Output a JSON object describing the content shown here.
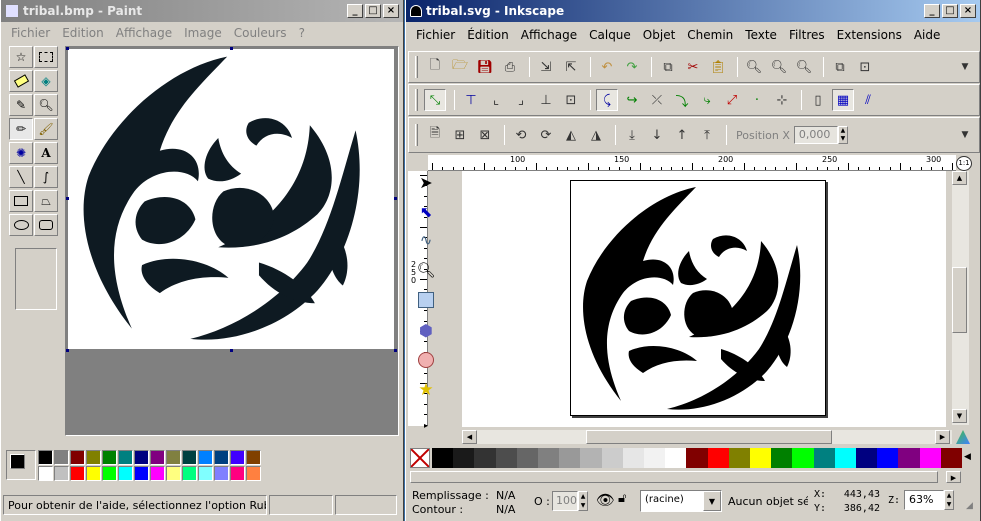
{
  "paint": {
    "title": "tribal.bmp - Paint",
    "menu": [
      "Fichier",
      "Edition",
      "Affichage",
      "Image",
      "Couleurs",
      "?"
    ],
    "palette_top": [
      "#000000",
      "#808080",
      "#800000",
      "#808000",
      "#008000",
      "#008080",
      "#000080",
      "#800080",
      "#808040",
      "#004040",
      "#0080ff",
      "#004080",
      "#4000ff",
      "#804000"
    ],
    "palette_bottom": [
      "#ffffff",
      "#c0c0c0",
      "#ff0000",
      "#ffff00",
      "#00ff00",
      "#00ffff",
      "#0000ff",
      "#ff00ff",
      "#ffff80",
      "#00ff80",
      "#80ffff",
      "#8080ff",
      "#ff0080",
      "#ff8040"
    ],
    "status": "Pour obtenir de l'aide, sélectionnez l'option Rubriques d'aide"
  },
  "inkscape": {
    "title": "tribal.svg - Inkscape",
    "menu": [
      "Fichier",
      "Édition",
      "Affichage",
      "Calque",
      "Objet",
      "Chemin",
      "Texte",
      "Filtres",
      "Extensions",
      "Aide"
    ],
    "position_label": "Position X",
    "position_value": "0,000",
    "ruler_top": [
      "100",
      "150",
      "200",
      "250",
      "300"
    ],
    "ruler_left": "250",
    "palette": [
      "#000000",
      "#1a1a1a",
      "#333333",
      "#4d4d4d",
      "#666666",
      "#808080",
      "#999999",
      "#b3b3b3",
      "#cccccc",
      "#e6e6e6",
      "#f2f2f2",
      "#ffffff",
      "#800000",
      "#ff0000",
      "#808000",
      "#ffff00",
      "#008000",
      "#00ff00",
      "#008080",
      "#00ffff",
      "#000080",
      "#0000ff",
      "#800080",
      "#ff00ff",
      "#800000"
    ],
    "status": {
      "fill_label": "Remplissage :",
      "fill_value": "N/A",
      "stroke_label": "Contour :",
      "stroke_value": "N/A",
      "opacity_label": "O :",
      "opacity_value": "100",
      "layer": "(racine)",
      "message": "Aucun objet sélectionné",
      "x_label": "X:",
      "x_value": "443,43",
      "y_label": "Y:",
      "y_value": "386,42",
      "zoom_label": "Z:",
      "zoom_value": "63%"
    }
  }
}
